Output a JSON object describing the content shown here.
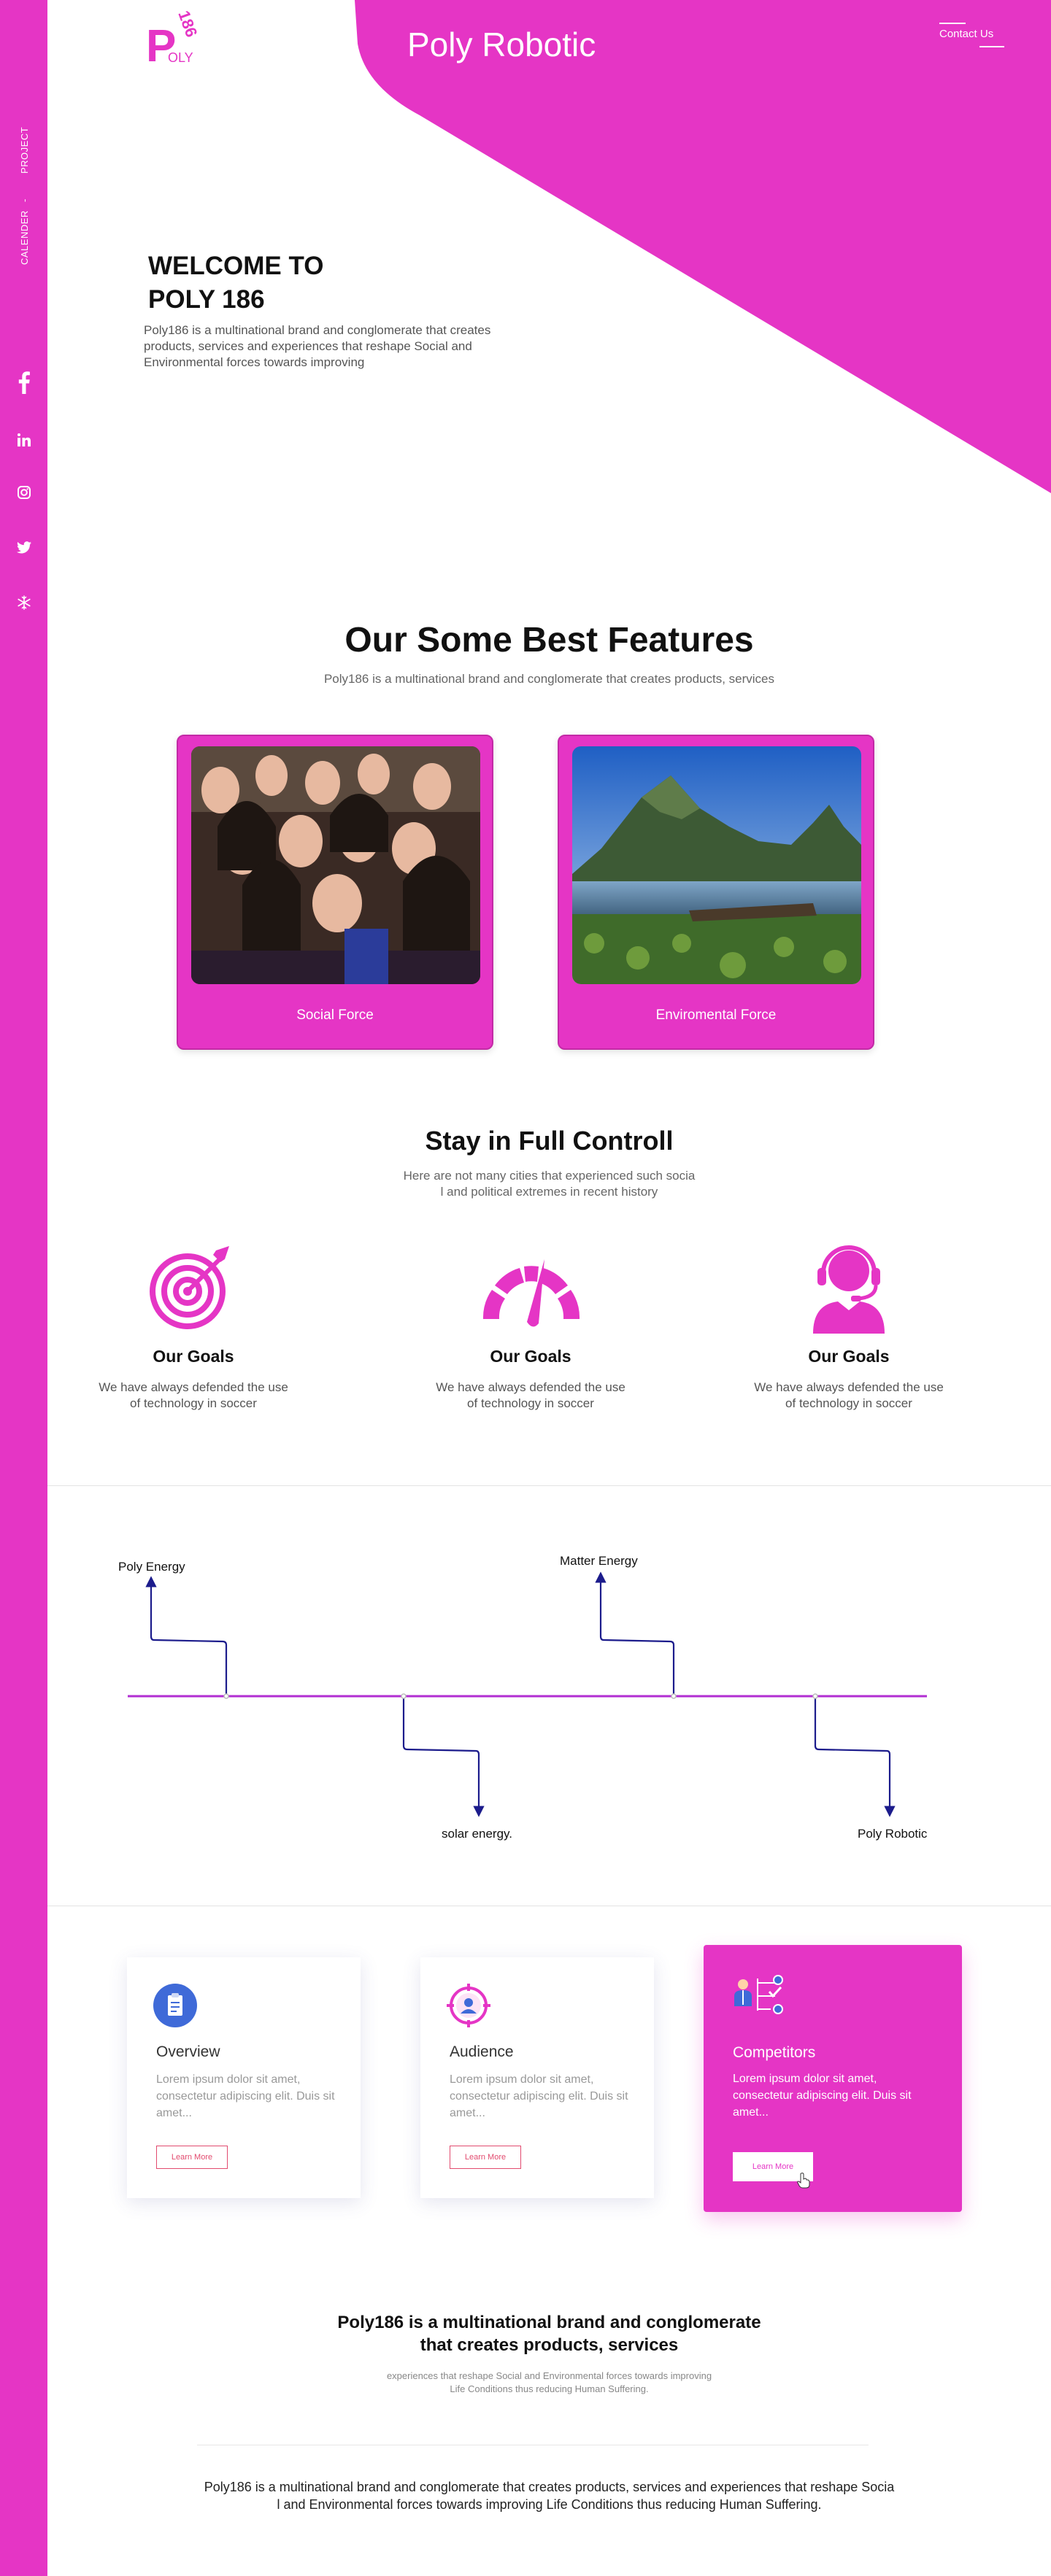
{
  "colors": {
    "brand": "#e535c5",
    "timeline_arrow": "#1c1c8c",
    "button_outline": "#e24b6f"
  },
  "sidebar": {
    "nav": [
      {
        "label": "PROJECT"
      },
      {
        "label": "-"
      },
      {
        "label": "CALENDER"
      }
    ],
    "social_icons": [
      "facebook-icon",
      "linkedin-icon",
      "instagram-icon",
      "twitter-icon",
      "snowflake-icon"
    ]
  },
  "header": {
    "logo": {
      "letter": "P",
      "word": "OLY",
      "number": "186"
    },
    "title": "Poly Robotic",
    "contact_label": "Contact Us"
  },
  "hero": {
    "title_line1": "WELCOME TO",
    "title_line2": "POLY 186",
    "text": "Poly186 is a multinational brand and conglomerate that creates products, services and experiences that reshape Social and Environmental forces towards improving"
  },
  "features": {
    "title": "Our Some Best Features",
    "subtitle": "Poly186 is a multinational brand and conglomerate that creates products, services",
    "cards": [
      {
        "label": "Social Force",
        "image": "group-selfie-photo"
      },
      {
        "label": "Enviromental Force",
        "image": "mountain-lake-photo"
      }
    ]
  },
  "control": {
    "title": "Stay in Full Controll",
    "subtitle_line1": "Here are not many cities that experienced such socia",
    "subtitle_line2": "l and political extremes in recent history",
    "goals": [
      {
        "icon": "target-icon",
        "title": "Our Goals",
        "text_line1": "We have always defended the use",
        "text_line2": "of technology in soccer"
      },
      {
        "icon": "speedometer-icon",
        "title": "Our Goals",
        "text_line1": "We have always defended the use",
        "text_line2": "of technology in soccer"
      },
      {
        "icon": "headset-support-icon",
        "title": "Our Goals",
        "text_line1": "We have always defended the use",
        "text_line2": "of technology in soccer"
      }
    ]
  },
  "timeline": {
    "items": [
      {
        "label": "Poly Energy",
        "direction": "up"
      },
      {
        "label": "solar energy.",
        "direction": "down"
      },
      {
        "label": "Matter Energy",
        "direction": "up"
      },
      {
        "label": "Poly Robotic",
        "direction": "down"
      }
    ]
  },
  "services": [
    {
      "icon": "clipboard-icon",
      "title": "Overview",
      "text": "Lorem ipsum dolor sit amet, consectetur adipiscing elit. Duis sit amet...",
      "button": "Learn More",
      "active": false
    },
    {
      "icon": "audience-target-icon",
      "title": "Audience",
      "text": "Lorem ipsum dolor sit amet, consectetur adipiscing elit. Duis sit amet...",
      "button": "Learn More",
      "active": false
    },
    {
      "icon": "competitors-checklist-icon",
      "title": "Competitors",
      "text": "Lorem ipsum dolor sit amet, consectetur adipiscing elit. Duis sit amet...",
      "button": "Learn More",
      "active": true
    }
  ],
  "footer": {
    "title_line1": "Poly186 is a multinational brand and conglomerate",
    "title_line2": "that creates products, services",
    "sub_line1": "experiences that reshape Social and Environmental forces towards improving",
    "sub_line2": "Life Conditions thus reducing Human Suffering.",
    "text_line1": "Poly186 is a multinational brand and conglomerate that creates products, services and experiences that reshape Socia",
    "text_line2": "l and Environmental forces towards improving Life Conditions thus reducing Human Suffering."
  }
}
